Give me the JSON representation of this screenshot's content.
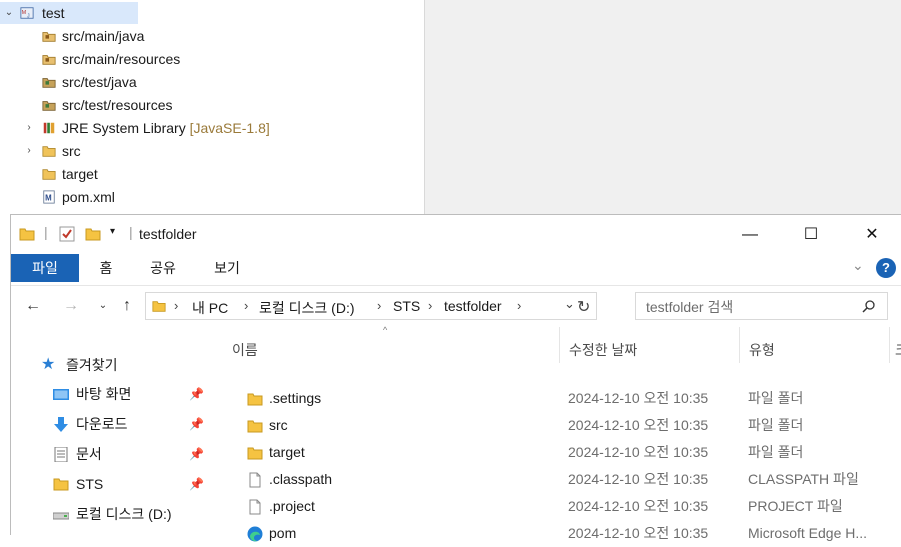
{
  "eclipse": {
    "project": "test",
    "items": [
      {
        "label": "src/main/java"
      },
      {
        "label": "src/main/resources"
      },
      {
        "label": "src/test/java"
      },
      {
        "label": "src/test/resources"
      },
      {
        "label": "JRE System Library",
        "decoration": "[JavaSE-1.8]"
      },
      {
        "label": "src"
      },
      {
        "label": "target"
      },
      {
        "label": "pom.xml"
      }
    ]
  },
  "explorer": {
    "title": "testfolder",
    "window_buttons": {
      "minimize": "—",
      "maximize": "☐",
      "close": "✕"
    },
    "ribbon_tabs": [
      "파일",
      "홈",
      "공유",
      "보기"
    ],
    "address": {
      "parts": [
        "내 PC",
        "로컬 디스크 (D:)",
        "STS",
        "testfolder"
      ]
    },
    "search": {
      "placeholder": "testfolder 검색"
    },
    "nav": {
      "quick_access": "즐겨찾기",
      "items": [
        {
          "label": "바탕 화면",
          "pinned": true
        },
        {
          "label": "다운로드",
          "pinned": true
        },
        {
          "label": "문서",
          "pinned": true
        },
        {
          "label": "STS",
          "pinned": true
        },
        {
          "label": "로컬 디스크 (D:)",
          "pinned": false
        }
      ]
    },
    "columns": [
      "이름",
      "수정한 날짜",
      "유형",
      "크"
    ],
    "files": [
      {
        "name": ".settings",
        "modified": "2024-12-10 오전 10:35",
        "type": "파일 폴더",
        "icon": "folder-icon"
      },
      {
        "name": "src",
        "modified": "2024-12-10 오전 10:35",
        "type": "파일 폴더",
        "icon": "folder-icon"
      },
      {
        "name": "target",
        "modified": "2024-12-10 오전 10:35",
        "type": "파일 폴더",
        "icon": "folder-icon"
      },
      {
        "name": ".classpath",
        "modified": "2024-12-10 오전 10:35",
        "type": "CLASSPATH 파일",
        "icon": "file-icon"
      },
      {
        "name": ".project",
        "modified": "2024-12-10 오전 10:35",
        "type": "PROJECT 파일",
        "icon": "file-icon"
      },
      {
        "name": "pom",
        "modified": "2024-12-10 오전 10:35",
        "type": "Microsoft Edge H...",
        "icon": "edge-icon"
      }
    ],
    "colors": {
      "accent": "#1a63b5",
      "folder": "#f5c342"
    }
  }
}
